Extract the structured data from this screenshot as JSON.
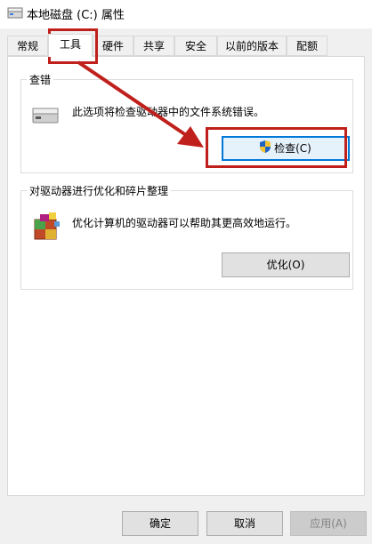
{
  "window": {
    "title": "本地磁盘 (C:) 属性"
  },
  "tabs": [
    {
      "label": "常规"
    },
    {
      "label": "工具"
    },
    {
      "label": "硬件"
    },
    {
      "label": "共享"
    },
    {
      "label": "安全"
    },
    {
      "label": "以前的版本"
    },
    {
      "label": "配额"
    }
  ],
  "selected_tab": "工具",
  "error_check": {
    "title": "查错",
    "description": "此选项将检查驱动器中的文件系统错误。",
    "button_label": "检查(C)"
  },
  "optimize": {
    "title": "对驱动器进行优化和碎片整理",
    "description": "优化计算机的驱动器可以帮助其更高效地运行。",
    "button_label": "优化(O)"
  },
  "footer": {
    "ok_label": "确定",
    "cancel_label": "取消",
    "apply_label": "应用(A)"
  },
  "colors": {
    "annotation_red": "#c0201b",
    "focus_blue": "#0078d7"
  }
}
